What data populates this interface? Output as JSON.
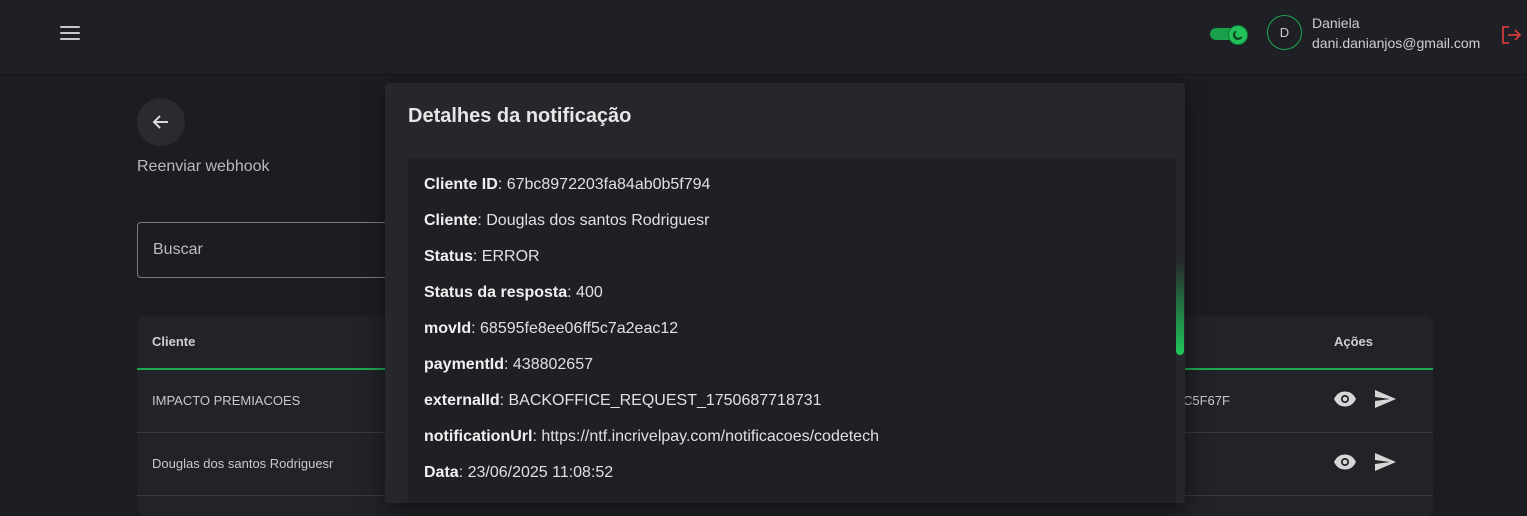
{
  "header": {
    "user_initial": "D",
    "user_name": "Daniela",
    "user_email": "dani.danianjos@gmail.com",
    "theme_toggle": "moon-icon",
    "accent_color": "#1fa751",
    "logout_color": "#d13a3a"
  },
  "page": {
    "title": "Reenviar webhook",
    "search_placeholder": "Buscar"
  },
  "table": {
    "headers": {
      "cliente": "Cliente",
      "acoes": "Ações"
    },
    "rows": [
      {
        "cliente": "IMPACTO PREMIACOES",
        "partial_id": "C5F67F"
      },
      {
        "cliente": "Douglas dos santos Rodriguesr",
        "partial_id": ""
      }
    ]
  },
  "modal": {
    "title": "Detalhes da notificação",
    "fields": [
      {
        "label": "Cliente ID",
        "value": "67bc8972203fa84ab0b5f794"
      },
      {
        "label": "Cliente",
        "value": "Douglas dos santos Rodriguesr"
      },
      {
        "label": "Status",
        "value": "ERROR"
      },
      {
        "label": "Status da resposta",
        "value": "400"
      },
      {
        "label": "movId",
        "value": "68595fe8ee06ff5c7a2eac12"
      },
      {
        "label": "paymentId",
        "value": "438802657"
      },
      {
        "label": "externalId",
        "value": "BACKOFFICE_REQUEST_1750687718731"
      },
      {
        "label": "notificationUrl",
        "value": "https://ntf.incrivelpay.com/notificacoes/codetech"
      },
      {
        "label": "Data",
        "value": "23/06/2025 11:08:52"
      }
    ]
  }
}
